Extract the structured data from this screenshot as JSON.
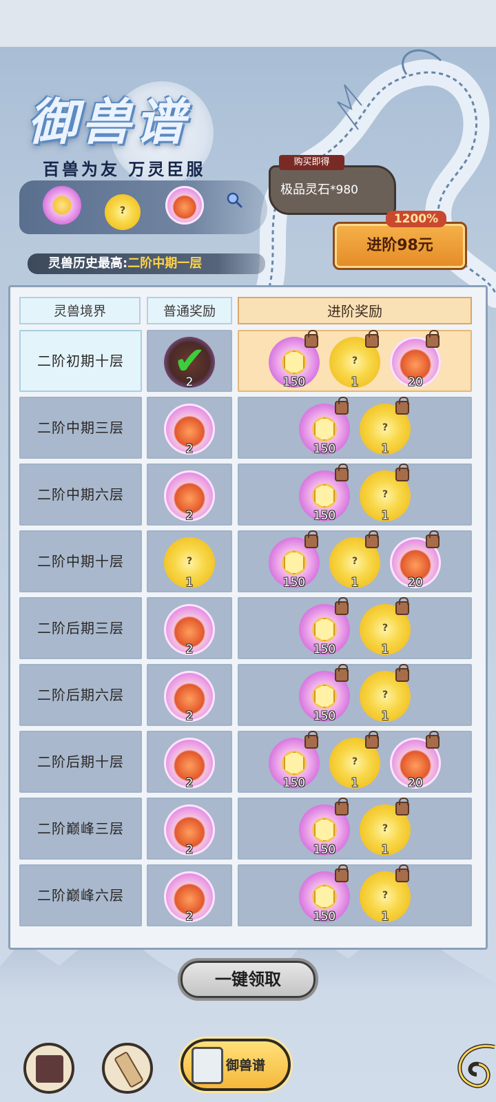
{
  "header": {
    "title": "御兽谱",
    "subtitle": "百兽为友 万灵臣服",
    "history_label": "灵兽历史最高:",
    "history_value": "二阶中期一层"
  },
  "purchase": {
    "tag": "购买即得",
    "item": "极品灵石",
    "amount": "*980",
    "bonus": "1200%",
    "button_label": "进阶98元"
  },
  "table": {
    "headers": [
      "灵兽境界",
      "普通奖励",
      "进阶奖励"
    ],
    "rows": [
      {
        "realm": "二阶初期十层",
        "normal": {
          "type": "fire",
          "count": "2",
          "claimed": true
        },
        "advanced": [
          {
            "type": "crystal",
            "count": "150"
          },
          {
            "type": "egg",
            "count": "1"
          },
          {
            "type": "fire",
            "count": "20"
          }
        ]
      },
      {
        "realm": "二阶中期三层",
        "normal": {
          "type": "fire",
          "count": "2"
        },
        "advanced": [
          {
            "type": "crystal",
            "count": "150"
          },
          {
            "type": "egg",
            "count": "1"
          }
        ]
      },
      {
        "realm": "二阶中期六层",
        "normal": {
          "type": "fire",
          "count": "2"
        },
        "advanced": [
          {
            "type": "crystal",
            "count": "150"
          },
          {
            "type": "egg",
            "count": "1"
          }
        ]
      },
      {
        "realm": "二阶中期十层",
        "normal": {
          "type": "egg",
          "count": "1"
        },
        "advanced": [
          {
            "type": "crystal",
            "count": "150"
          },
          {
            "type": "egg",
            "count": "1"
          },
          {
            "type": "fire",
            "count": "20"
          }
        ]
      },
      {
        "realm": "二阶后期三层",
        "normal": {
          "type": "fire",
          "count": "2"
        },
        "advanced": [
          {
            "type": "crystal",
            "count": "150"
          },
          {
            "type": "egg",
            "count": "1"
          }
        ]
      },
      {
        "realm": "二阶后期六层",
        "normal": {
          "type": "fire",
          "count": "2"
        },
        "advanced": [
          {
            "type": "crystal",
            "count": "150"
          },
          {
            "type": "egg",
            "count": "1"
          }
        ]
      },
      {
        "realm": "二阶后期十层",
        "normal": {
          "type": "fire",
          "count": "2"
        },
        "advanced": [
          {
            "type": "crystal",
            "count": "150"
          },
          {
            "type": "egg",
            "count": "1"
          },
          {
            "type": "fire",
            "count": "20"
          }
        ]
      },
      {
        "realm": "二阶巅峰三层",
        "normal": {
          "type": "fire",
          "count": "2"
        },
        "advanced": [
          {
            "type": "crystal",
            "count": "150"
          },
          {
            "type": "egg",
            "count": "1"
          }
        ]
      },
      {
        "realm": "二阶巅峰六层",
        "normal": {
          "type": "fire",
          "count": "2"
        },
        "advanced": [
          {
            "type": "crystal",
            "count": "150"
          },
          {
            "type": "egg",
            "count": "1"
          }
        ]
      }
    ]
  },
  "claim_all_label": "一键领取",
  "bottom_nav": {
    "active_label": "御兽谱",
    "icons": [
      "book-icon",
      "scroll-icon",
      "bestiary-icon",
      "swirl-icon"
    ]
  },
  "colors": {
    "accent_orange": "#e48b26",
    "advanced_header_bg": "#fae0b5",
    "row_bg": "#a9b8cc"
  }
}
